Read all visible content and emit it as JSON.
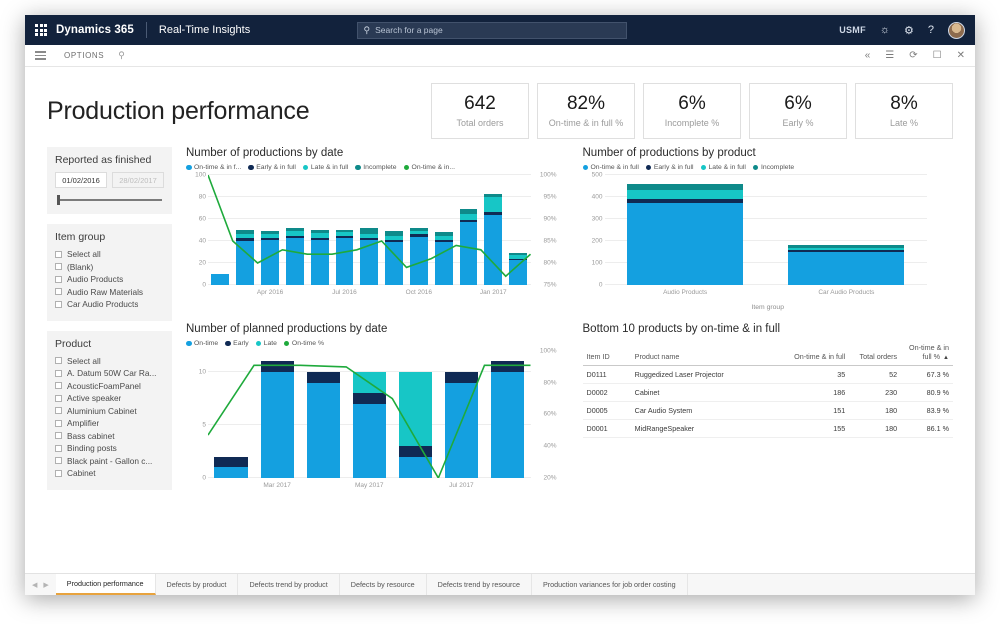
{
  "topnav": {
    "brand": "Dynamics 365",
    "module": "Real-Time Insights",
    "search_placeholder": "Search for a page",
    "company": "USMF",
    "icons": [
      "waffle-icon",
      "search-icon",
      "notification-bell-icon",
      "gear-icon",
      "help-icon",
      "avatar"
    ]
  },
  "optionsbar": {
    "label": "OPTIONS",
    "right_icons": [
      "collapse-icon",
      "book-icon",
      "refresh-icon",
      "popout-icon",
      "close-icon"
    ]
  },
  "header": {
    "title": "Production performance",
    "kpis": [
      {
        "value": "642",
        "label": "Total orders"
      },
      {
        "value": "82%",
        "label": "On-time & in full %"
      },
      {
        "value": "6%",
        "label": "Incomplete %"
      },
      {
        "value": "6%",
        "label": "Early %"
      },
      {
        "value": "8%",
        "label": "Late %"
      }
    ]
  },
  "filters": {
    "reported": {
      "title": "Reported as finished",
      "date_from": "01/02/2016",
      "date_to": "28/02/2017"
    },
    "item_group": {
      "title": "Item group",
      "items": [
        "Select all",
        "(Blank)",
        "Audio Products",
        "Audio Raw Materials",
        "Car Audio Products"
      ]
    },
    "product": {
      "title": "Product",
      "items": [
        "Select all",
        "A. Datum 50W Car Ra...",
        "AcousticFoamPanel",
        "Active speaker",
        "Aluminium Cabinet",
        "Amplifier",
        "Bass cabinet",
        "Binding posts",
        "Black paint - Gallon c...",
        "Cabinet"
      ]
    }
  },
  "colors": {
    "on_time": "#14a0e0",
    "early": "#102a54",
    "late": "#17c6c6",
    "incomplete": "#0e8a8a",
    "pct_line": "#1faa3c",
    "accent": "#e8a33d"
  },
  "chart_data": [
    {
      "id": "productions_by_date",
      "type": "bar",
      "title": "Number of productions by date",
      "legend": [
        {
          "label": "On-time & in f...",
          "color": "#14a0e0"
        },
        {
          "label": "Early & in full",
          "color": "#102a54"
        },
        {
          "label": "Late & in full",
          "color": "#17c6c6"
        },
        {
          "label": "Incomplete",
          "color": "#0e8a8a"
        },
        {
          "label": "On-time & in...",
          "color": "#1faa3c"
        }
      ],
      "categories": [
        "Feb 2016",
        "Mar 2016",
        "Apr 2016",
        "May 2016",
        "Jun 2016",
        "Jul 2016",
        "Aug 2016",
        "Sep 2016",
        "Oct 2016",
        "Nov 2016",
        "Dec 2016",
        "Jan 2017",
        "Feb 2017"
      ],
      "xtick_labels": [
        "Apr 2016",
        "Jul 2016",
        "Oct 2016",
        "Jan 2017"
      ],
      "xtick_indices": [
        2,
        5,
        8,
        11
      ],
      "series": [
        {
          "name": "On-time & in full",
          "color": "#14a0e0",
          "values": [
            10,
            40,
            41,
            43,
            41,
            43,
            41,
            39,
            44,
            39,
            57,
            64,
            23
          ]
        },
        {
          "name": "Early & in full",
          "color": "#102a54",
          "values": [
            0,
            3,
            2,
            2,
            2,
            2,
            2,
            2,
            2,
            2,
            2,
            2,
            1
          ]
        },
        {
          "name": "Late & in full",
          "color": "#17c6c6",
          "values": [
            0,
            3,
            3,
            4,
            4,
            3,
            3,
            4,
            3,
            4,
            6,
            14,
            3
          ]
        },
        {
          "name": "Incomplete",
          "color": "#0e8a8a",
          "values": [
            0,
            4,
            3,
            3,
            3,
            2,
            6,
            4,
            3,
            3,
            4,
            3,
            2
          ]
        }
      ],
      "line_series": {
        "name": "On-time & in full %",
        "color": "#1faa3c",
        "values": [
          100,
          85,
          80,
          83,
          82,
          82,
          83,
          85,
          79,
          81,
          84,
          83,
          77,
          82
        ]
      },
      "ylabel": "",
      "ylim": [
        0,
        100
      ],
      "yticks": [
        0,
        20,
        40,
        60,
        80,
        100
      ],
      "y2lim": [
        75,
        100
      ],
      "y2ticks": [
        "75%",
        "80%",
        "85%",
        "90%",
        "95%",
        "100%"
      ],
      "xlabel": "",
      "grid": true
    },
    {
      "id": "productions_by_product",
      "type": "bar",
      "title": "Number of productions by product",
      "legend": [
        {
          "label": "On-time & in full",
          "color": "#14a0e0"
        },
        {
          "label": "Early & in full",
          "color": "#102a54"
        },
        {
          "label": "Late & in full",
          "color": "#17c6c6"
        },
        {
          "label": "Incomplete",
          "color": "#0e8a8a"
        }
      ],
      "categories": [
        "Audio Products",
        "Car Audio Products"
      ],
      "series": [
        {
          "name": "On-time & in full",
          "color": "#14a0e0",
          "values": [
            375,
            152
          ]
        },
        {
          "name": "Early & in full",
          "color": "#102a54",
          "values": [
            16,
            7
          ]
        },
        {
          "name": "Late & in full",
          "color": "#17c6c6",
          "values": [
            42,
            9
          ]
        },
        {
          "name": "Incomplete",
          "color": "#0e8a8a",
          "values": [
            27,
            12
          ]
        }
      ],
      "ylim": [
        0,
        500
      ],
      "yticks": [
        0,
        100,
        200,
        300,
        400,
        500
      ],
      "xlabel": "Item group",
      "grid": true
    },
    {
      "id": "planned_productions_by_date",
      "type": "bar",
      "title": "Number of planned productions by date",
      "legend": [
        {
          "label": "On-time",
          "color": "#14a0e0"
        },
        {
          "label": "Early",
          "color": "#102a54"
        },
        {
          "label": "Late",
          "color": "#17c6c6"
        },
        {
          "label": "On-time %",
          "color": "#1faa3c"
        }
      ],
      "categories": [
        "Feb 2017",
        "Mar 2017",
        "Apr 2017",
        "May 2017",
        "Jun 2017",
        "Jul 2017",
        "Aug 2017"
      ],
      "xtick_labels": [
        "Mar 2017",
        "May 2017",
        "Jul 2017"
      ],
      "xtick_indices": [
        1,
        3,
        5
      ],
      "series": [
        {
          "name": "On-time",
          "color": "#14a0e0",
          "values": [
            1,
            10,
            9,
            7,
            2,
            9,
            10
          ]
        },
        {
          "name": "Early",
          "color": "#102a54",
          "values": [
            1,
            1,
            1,
            1,
            1,
            1,
            1
          ]
        },
        {
          "name": "Late",
          "color": "#17c6c6",
          "values": [
            0,
            0,
            0,
            2,
            7,
            0,
            0
          ]
        }
      ],
      "line_series": {
        "name": "On-time %",
        "color": "#1faa3c",
        "values": [
          47,
          91,
          91,
          90,
          70,
          20,
          91,
          91
        ]
      },
      "ylim": [
        0,
        12
      ],
      "yticks": [
        0,
        5,
        10
      ],
      "y2lim": [
        20,
        100
      ],
      "y2ticks": [
        "20%",
        "40%",
        "60%",
        "80%",
        "100%"
      ],
      "xlabel": "",
      "grid": true
    }
  ],
  "table": {
    "title": "Bottom 10 products by on-time & in full",
    "columns": [
      "Item ID",
      "Product name",
      "On-time & in full",
      "Total orders",
      "On-time & in full %"
    ],
    "sort_column": "On-time & in full %",
    "sort_direction": "ascending",
    "rows": [
      {
        "item_id": "D0111",
        "product_name": "Ruggedized Laser Projector",
        "on_time_in_full": "35",
        "total_orders": "52",
        "pct": "67.3 %"
      },
      {
        "item_id": "D0002",
        "product_name": "Cabinet",
        "on_time_in_full": "186",
        "total_orders": "230",
        "pct": "80.9 %"
      },
      {
        "item_id": "D0005",
        "product_name": "Car Audio System",
        "on_time_in_full": "151",
        "total_orders": "180",
        "pct": "83.9 %"
      },
      {
        "item_id": "D0001",
        "product_name": "MidRangeSpeaker",
        "on_time_in_full": "155",
        "total_orders": "180",
        "pct": "86.1 %"
      }
    ]
  },
  "tabs": [
    {
      "label": "Production performance",
      "active": true
    },
    {
      "label": "Defects by product",
      "active": false
    },
    {
      "label": "Defects trend by product",
      "active": false
    },
    {
      "label": "Defects by resource",
      "active": false
    },
    {
      "label": "Defects trend by resource",
      "active": false
    },
    {
      "label": "Production variances for job order costing",
      "active": false
    }
  ]
}
